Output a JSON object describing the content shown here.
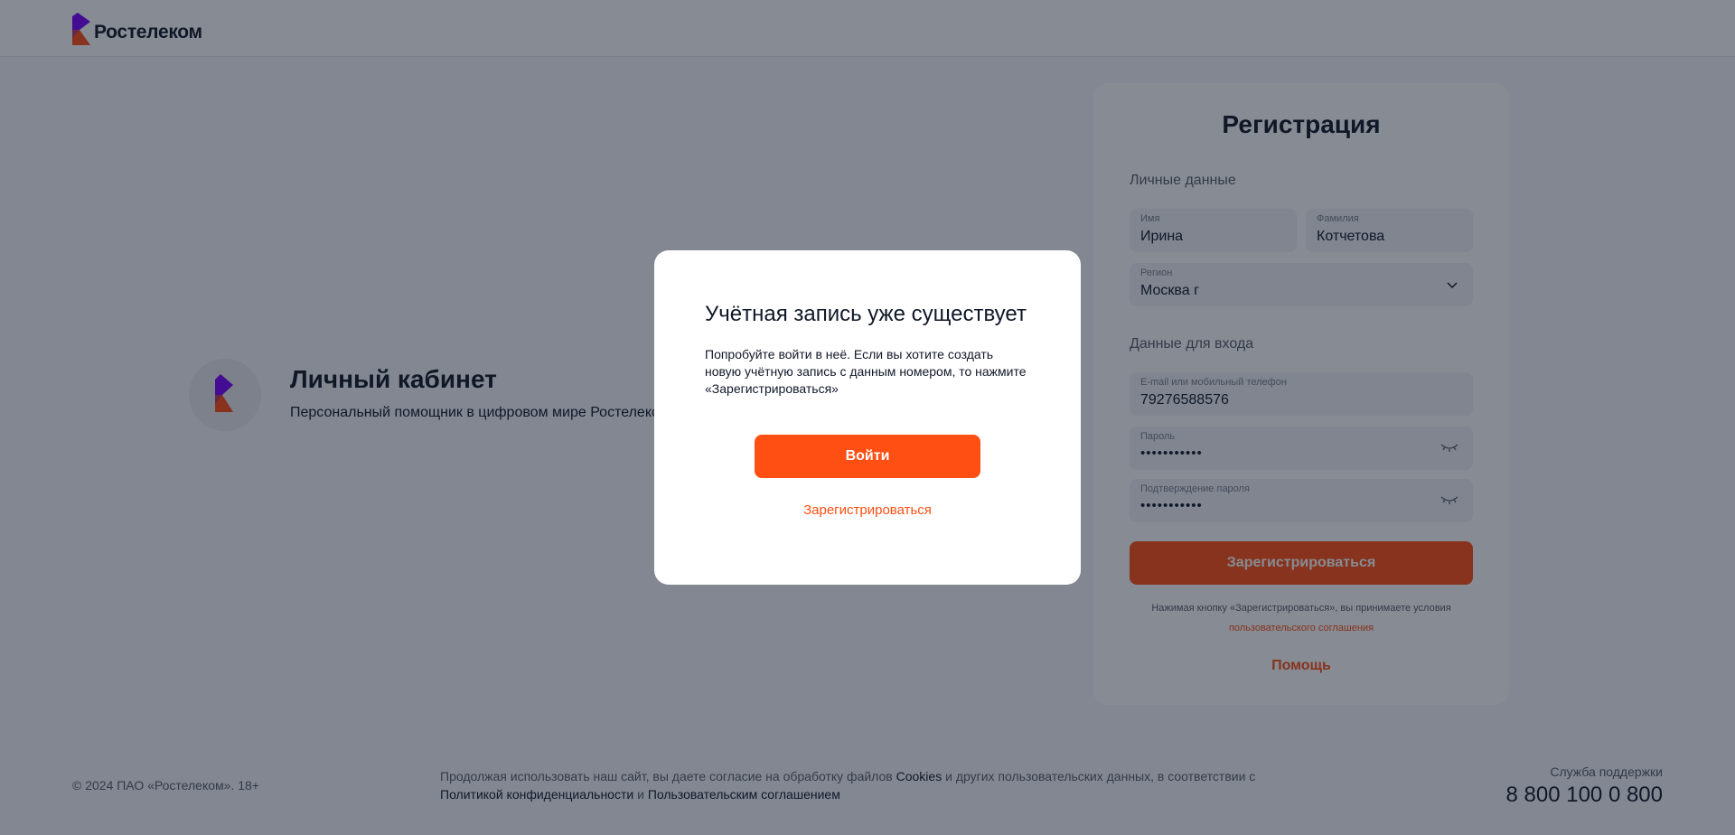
{
  "header": {
    "brand_name": "Ростелеком",
    "logo_icon": "rostelecom-logo-icon"
  },
  "promo": {
    "title": "Личный кабинет",
    "subtitle": "Персональный помощник в цифровом мире Ростелеком"
  },
  "registration": {
    "title": "Регистрация",
    "personal_section": "Личные данные",
    "first_name": {
      "label": "Имя",
      "value": "Ирина"
    },
    "last_name": {
      "label": "Фамилия",
      "value": "Котчетова"
    },
    "region": {
      "label": "Регион",
      "value": "Москва г",
      "icon": "chevron-down-icon"
    },
    "login_section": "Данные для входа",
    "login": {
      "label": "E-mail или мобильный телефон",
      "value": "79276588576"
    },
    "password": {
      "label": "Пароль",
      "value": "•••••••••••",
      "icon": "eye-closed-icon"
    },
    "password_confirm": {
      "label": "Подтверждение пароля",
      "value": "•••••••••••",
      "icon": "eye-closed-icon"
    },
    "submit_label": "Зарегистрироваться",
    "terms_text": "Нажимая кнопку «Зарегистрироваться», вы принимаете условия",
    "terms_link": "пользовательского соглашения",
    "help_label": "Помощь"
  },
  "footer": {
    "copyright": "© 2024 ПАО «Ростелеком». 18+",
    "consent_part1": "Продолжая использовать наш сайт, вы даете согласие на обработку файлов ",
    "consent_cookies": "Cookies",
    "consent_part2": " и других пользовательских данных, в соответствии с ",
    "consent_privacy": "Политикой конфиденциальности",
    "consent_and": " и ",
    "consent_agreement": "Пользовательским соглашением",
    "support_label": "Служба поддержки",
    "support_phone": "8 800 100 0 800"
  },
  "modal": {
    "title": "Учётная запись уже существует",
    "text": "Попробуйте войти в неё. Если вы хотите создать новую учётную запись с данным номером, то нажмите «Зарегистрироваться»",
    "login_label": "Войти",
    "register_label": "Зарегистрироваться"
  },
  "colors": {
    "accent": "#ff4f12",
    "brand_purple": "#7700ff",
    "text": "#101828",
    "muted": "#575d68"
  }
}
